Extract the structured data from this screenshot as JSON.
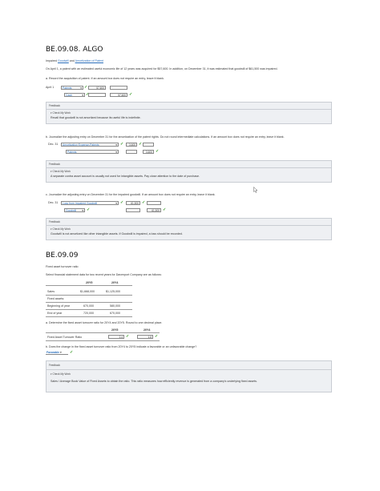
{
  "s1": {
    "title": "BE.09.08. ALGO",
    "subtitle": "Impaired Goodwill and Amortization of Patent",
    "subtitle_pre": "Impaired ",
    "subtitle_link1": "Goodwill",
    "subtitle_mid": " and ",
    "subtitle_link2": "Amortization of Patent",
    "intro": "On April 1, a patent with an estimated useful economic life of 12 years was acquired for $57,600. In addition, on December 31, it was estimated that goodwill of $61,500 was impaired.",
    "qa": {
      "prompt": "a.  Record the acquisition of patent. If an amount box does not require an entry, leave it blank.",
      "date": "April 1",
      "row1_account": "Patents",
      "row1_debit": "57,600",
      "row2_account": "Cash",
      "row2_credit": "57,600",
      "fb_title": "Feedback",
      "fb_check": "▾ Check My Work",
      "fb_text": "Recall that goodwill is not amortized because its useful life is indefinite."
    },
    "qb": {
      "prompt": "b.  Journalize the adjusting entry on December 31 for the amortization of the patent rights. Do not round intermediate calculations. If an amount box does not require an entry, leave it blank.",
      "date": "Dec. 31",
      "row1_account": "Amortization Expense-Patents",
      "row1_debit": "3,600",
      "row2_account": "Patents",
      "row2_credit": "3,600",
      "fb_title": "Feedback",
      "fb_check": "▾ Check My Work",
      "fb_text": "A separate contra asset account is usually not used for intangible assets. Pay close attention to the date of purchase."
    },
    "qc": {
      "prompt": "c.  Journalize the adjusting entry on December 31 for the impaired goodwill. If an amount box does not require an entry, leave it blank.",
      "date": "Dec. 31",
      "row1_account": "Loss from Impaired Goodwill",
      "row1_debit": "61,500",
      "row2_account": "Goodwill",
      "row2_credit": "61,500",
      "fb_title": "Feedback",
      "fb_check": "▾ Check My Work",
      "fb_text": "Goodwill is not amortized like other intangible assets. If Goodwill is impaired, a loss should be recorded."
    }
  },
  "s2": {
    "title": "BE.09.09",
    "subtitle": "Fixed asset turnover ratio",
    "intro": "Select financial statement data for two recent years for Davenport Company are as follows:",
    "table": {
      "col1": "20Y5",
      "col2": "20Y4",
      "rows": [
        {
          "label": "Sales",
          "v1": "$1,668,000",
          "v2": "$1,125,000"
        },
        {
          "label": "Fixed assets:",
          "v1": "",
          "v2": ""
        },
        {
          "label": "Beginning of year",
          "v1": "670,000",
          "v2": "580,000"
        },
        {
          "label": "End of year",
          "v1": "720,000",
          "v2": "670,000"
        }
      ]
    },
    "qa": {
      "prompt": "a.  Determine the fixed asset turnover ratio for 20Y4 and 20Y5. Round to one decimal place.",
      "col1": "20Y5",
      "col2": "20Y4",
      "row_label": "Fixed Asset Turnover Ratio",
      "v1": "2.4",
      "v2": "1.8"
    },
    "qb": {
      "prompt": "b.  Does the change in the fixed asset turnover ratio from 20Y4 to 20Y5 indicate a favorable or an unfavorable change?",
      "answer": "Favorable"
    },
    "fb": {
      "title": "Feedback",
      "check": "▾ Check My Work",
      "text": "Sales / Average Book Value of Fixed Assets to obtain the ratio. This ratio measures how efficiently revenue is generated from a company's underlying fixed assets."
    }
  },
  "ui": {
    "check_glyph": "✓",
    "caret_glyph": "▾"
  }
}
